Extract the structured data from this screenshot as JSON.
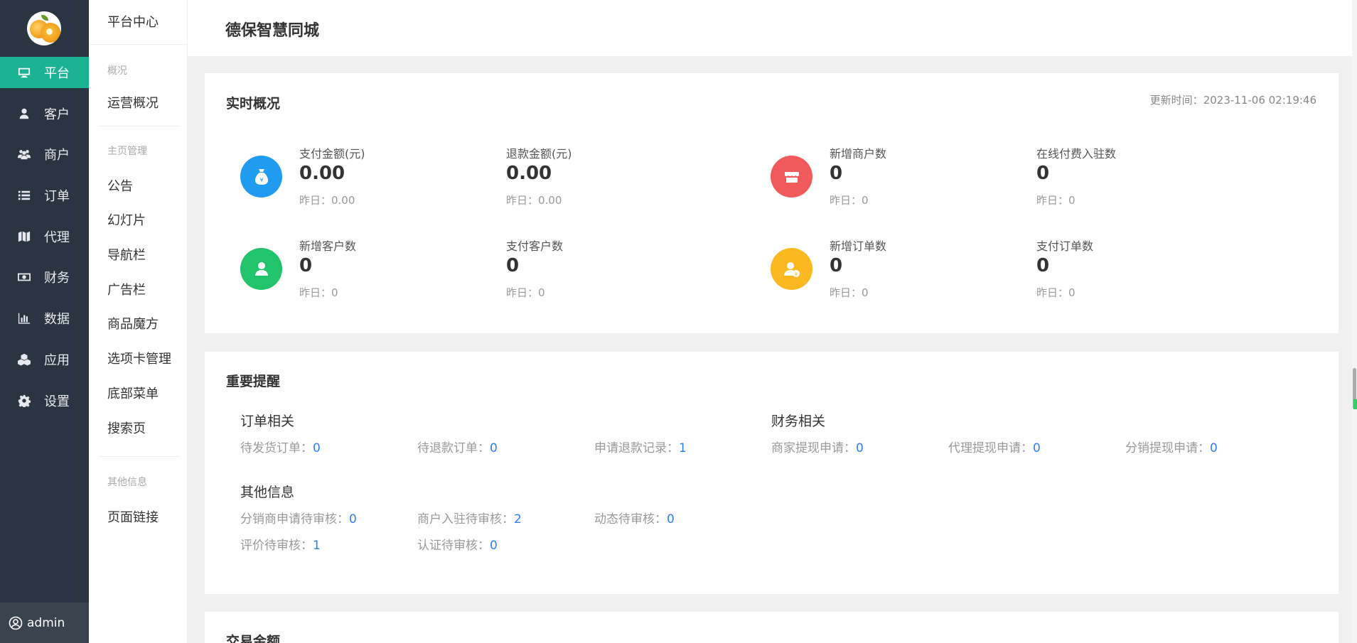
{
  "sidebar": {
    "items": [
      {
        "label": "平台",
        "icon": "monitor-icon",
        "active": true
      },
      {
        "label": "客户",
        "icon": "user-icon"
      },
      {
        "label": "商户",
        "icon": "users-icon"
      },
      {
        "label": "订单",
        "icon": "list-icon"
      },
      {
        "label": "代理",
        "icon": "map-icon"
      },
      {
        "label": "财务",
        "icon": "money-icon"
      },
      {
        "label": "数据",
        "icon": "bar-chart-icon"
      },
      {
        "label": "应用",
        "icon": "cubes-icon"
      },
      {
        "label": "设置",
        "icon": "gear-icon"
      }
    ],
    "user": "admin"
  },
  "subnav": {
    "head": "平台中心",
    "group1_label": "概况",
    "group1_items": [
      "运营概况"
    ],
    "group2_label": "主页管理",
    "group2_items": [
      "公告",
      "幻灯片",
      "导航栏",
      "广告栏",
      "商品魔方",
      "选项卡管理",
      "底部菜单",
      "搜索页"
    ],
    "group3_label": "其他信息",
    "group3_items": [
      "页面链接"
    ]
  },
  "header": {
    "title": "德保智慧同城"
  },
  "realtime": {
    "title": "实时概况",
    "update_label": "更新时间：",
    "update_time": "2023-11-06 02:19:46",
    "stats": [
      {
        "label": "支付金额(元)",
        "value": "0.00",
        "yesterday": "昨日：0.00"
      },
      {
        "label": "退款金额(元)",
        "value": "0.00",
        "yesterday": "昨日：0.00"
      },
      {
        "label": "新增商户数",
        "value": "0",
        "yesterday": "昨日：0"
      },
      {
        "label": "在线付费入驻数",
        "value": "0",
        "yesterday": "昨日：0"
      },
      {
        "label": "新增客户数",
        "value": "0",
        "yesterday": "昨日：0"
      },
      {
        "label": "支付客户数",
        "value": "0",
        "yesterday": "昨日：0"
      },
      {
        "label": "新增订单数",
        "value": "0",
        "yesterday": "昨日：0"
      },
      {
        "label": "支付订单数",
        "value": "0",
        "yesterday": "昨日：0"
      }
    ],
    "colors": {
      "blue": "#1f9bf0",
      "red": "#f05a5a",
      "green": "#21c46b",
      "yellow": "#fbb821"
    }
  },
  "reminders": {
    "title": "重要提醒",
    "order_title": "订单相关",
    "finance_title": "财务相关",
    "other_title": "其他信息",
    "orders": [
      {
        "label": "待发货订单：",
        "value": "0"
      },
      {
        "label": "待退款订单：",
        "value": "0"
      },
      {
        "label": "申请退款记录：",
        "value": "1"
      }
    ],
    "finance": [
      {
        "label": "商家提现申请：",
        "value": "0"
      },
      {
        "label": "代理提现申请：",
        "value": "0"
      },
      {
        "label": "分销提现申请：",
        "value": "0"
      }
    ],
    "other": [
      {
        "label": "分销商申请待审核：",
        "value": "0"
      },
      {
        "label": "商户入驻待审核：",
        "value": "2"
      },
      {
        "label": "动态待审核：",
        "value": "0"
      },
      {
        "label": "评价待审核：",
        "value": "1"
      },
      {
        "label": "认证待审核：",
        "value": "0"
      }
    ]
  },
  "trade": {
    "title": "交易金额"
  }
}
